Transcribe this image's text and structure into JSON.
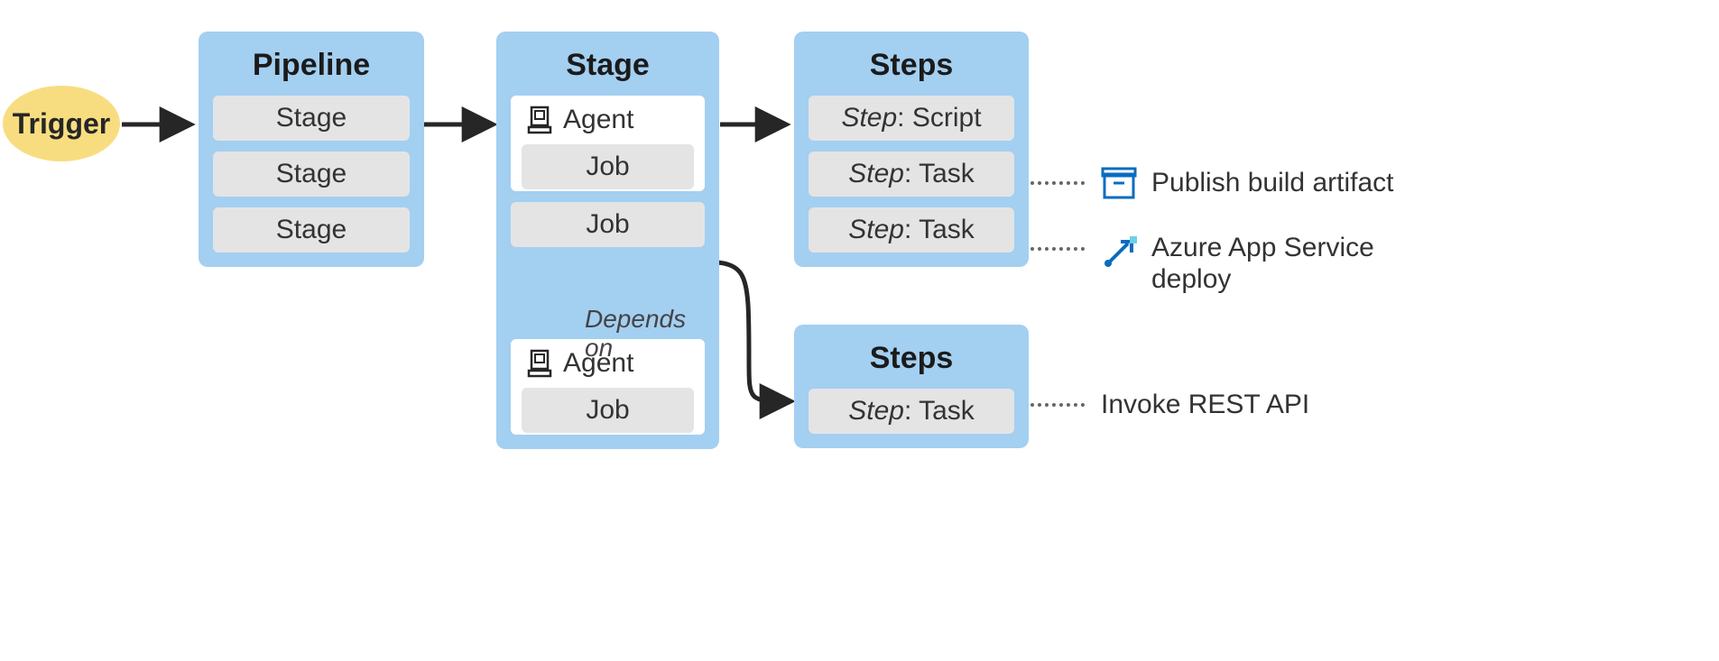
{
  "trigger": {
    "label": "Trigger"
  },
  "pipeline": {
    "title": "Pipeline",
    "stages": [
      "Stage",
      "Stage",
      "Stage"
    ]
  },
  "stage": {
    "title": "Stage",
    "agent1_label": "Agent",
    "agent1_job": "Job",
    "middle_job": "Job",
    "depends_label": "Depends on",
    "agent2_label": "Agent",
    "agent2_job": "Job"
  },
  "steps1": {
    "title": "Steps",
    "rows": [
      {
        "prefix": "Step",
        "suffix": ": Script"
      },
      {
        "prefix": "Step",
        "suffix": ": Task"
      },
      {
        "prefix": "Step",
        "suffix": ": Task"
      }
    ]
  },
  "steps2": {
    "title": "Steps",
    "rows": [
      {
        "prefix": "Step",
        "suffix": ": Task"
      }
    ]
  },
  "annotations": {
    "publish": "Publish build artifact",
    "deploy": "Azure App Service deploy",
    "invoke": "Invoke REST API"
  }
}
